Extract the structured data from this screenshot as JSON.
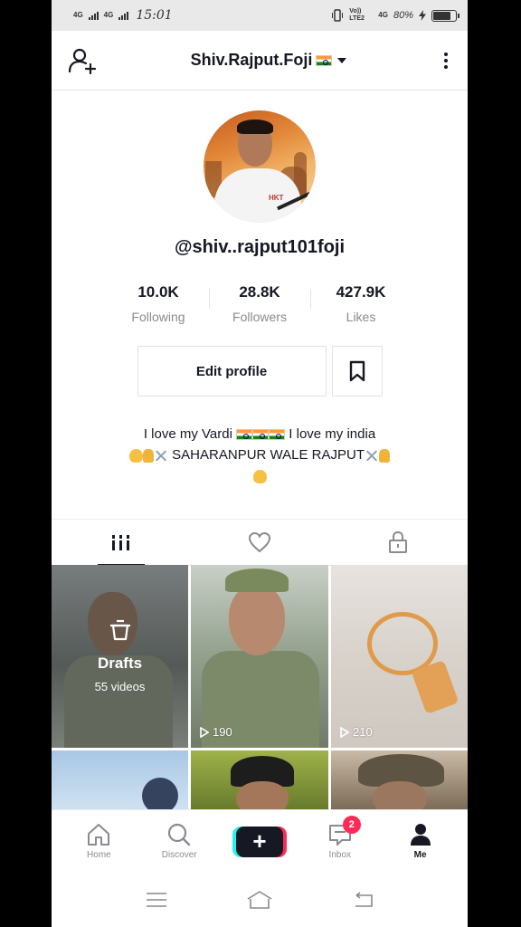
{
  "status_bar": {
    "network1": "4G",
    "network2": "4G",
    "time": "15:01",
    "volte": "Vo)) LTE2",
    "net3": "4G",
    "battery": "80%"
  },
  "header": {
    "title": "Shiv.Rajput.Foji"
  },
  "profile": {
    "username": "@shiv..rajput101foji",
    "stats": [
      {
        "value": "10.0K",
        "label": "Following"
      },
      {
        "value": "28.8K",
        "label": "Followers"
      },
      {
        "value": "427.9K",
        "label": "Likes"
      }
    ],
    "edit_label": "Edit profile",
    "bio_line1_a": "I love my Vardi",
    "bio_line1_b": "I love my india",
    "bio_line2": "SAHARANPUR WALE RAJPUT"
  },
  "grid": {
    "drafts_label": "Drafts",
    "drafts_count": "55 videos",
    "video2_views": "190",
    "video3_views": "210"
  },
  "bottom_nav": {
    "home": "Home",
    "discover": "Discover",
    "inbox": "Inbox",
    "inbox_badge": "2",
    "me": "Me"
  },
  "colors": {
    "accent_red": "#fe2c55",
    "accent_cyan": "#25f4ee",
    "text": "#161823",
    "muted": "#8a8b91"
  }
}
